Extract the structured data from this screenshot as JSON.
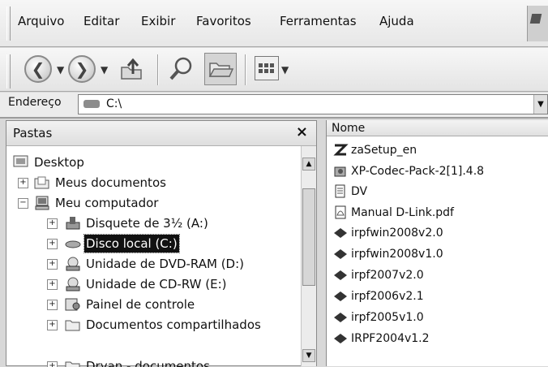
{
  "menu": [
    "Arquivo",
    "Editar",
    "Exibir",
    "Favoritos",
    "Ferramentas",
    "Ajuda"
  ],
  "address": {
    "label": "Endereço",
    "value": "C:\\"
  },
  "folders_pane": {
    "title": "Pastas",
    "close_label": "×",
    "items": [
      {
        "label": "Desktop",
        "expander": ""
      },
      {
        "label": "Meus documentos",
        "expander": "+"
      },
      {
        "label": "Meu computador",
        "expander": "−"
      },
      {
        "label": "Disquete de 3½ (A:)",
        "expander": "+"
      },
      {
        "label": "Disco local (C:)",
        "expander": "+",
        "selected": true
      },
      {
        "label": "Unidade de DVD-RAM (D:)",
        "expander": "+"
      },
      {
        "label": "Unidade de CD-RW (E:)",
        "expander": "+"
      },
      {
        "label": "Painel de controle",
        "expander": "+"
      },
      {
        "label": "Documentos compartilhados",
        "expander": "+"
      },
      {
        "label": "Dryan - documentos",
        "expander": "+"
      }
    ]
  },
  "files_pane": {
    "column_header": "Nome",
    "items": [
      {
        "name": "zaSetup_en",
        "icon": "zonealarm-icon"
      },
      {
        "name": "XP-Codec-Pack-2[1].4.8",
        "icon": "installer-icon"
      },
      {
        "name": "DV",
        "icon": "document-icon"
      },
      {
        "name": "Manual D-Link.pdf",
        "icon": "pdf-icon"
      },
      {
        "name": "irpfwin2008v2.0",
        "icon": "program-icon"
      },
      {
        "name": "irpfwin2008v1.0",
        "icon": "program-icon"
      },
      {
        "name": "irpf2007v2.0",
        "icon": "program-icon"
      },
      {
        "name": "irpf2006v2.1",
        "icon": "program-icon"
      },
      {
        "name": "irpf2005v1.0",
        "icon": "program-icon"
      },
      {
        "name": "IRPF2004v1.2",
        "icon": "program-icon"
      }
    ]
  }
}
